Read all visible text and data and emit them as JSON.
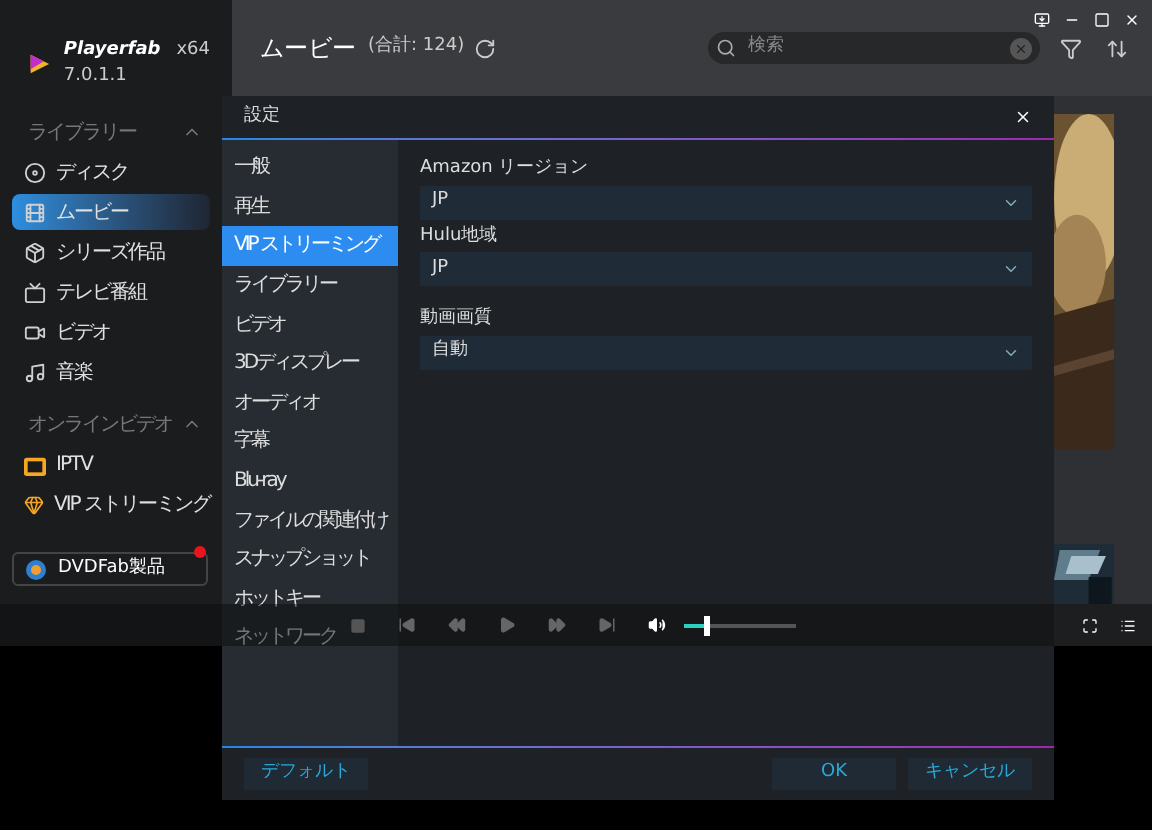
{
  "app": {
    "name": "Playerfab",
    "arch": "x64",
    "version": "7.0.1.1"
  },
  "sidebar": {
    "sections": [
      {
        "title": "ライブラリー",
        "expanded": true,
        "items": [
          {
            "label": "ディスク",
            "kind": "disc",
            "selected": false
          },
          {
            "label": "ムービー",
            "kind": "film",
            "selected": true
          },
          {
            "label": "シリーズ作品",
            "kind": "box",
            "selected": false
          },
          {
            "label": "テレビ番組",
            "kind": "tv",
            "selected": false
          },
          {
            "label": "ビデオ",
            "kind": "camera",
            "selected": false
          },
          {
            "label": "音楽",
            "kind": "music",
            "selected": false
          }
        ]
      },
      {
        "title": "オンラインビデオ",
        "expanded": true,
        "items": [
          {
            "label": "IPTV",
            "kind": "iptv",
            "selected": false
          },
          {
            "label": "VIP ストリーミング",
            "kind": "vip",
            "selected": false
          }
        ]
      }
    ],
    "product_button": {
      "label": "DVDFab製品",
      "notification": true
    }
  },
  "header": {
    "title": "ムービー",
    "count": "(合計: 124)",
    "search": {
      "placeholder": "検索"
    }
  },
  "settings": {
    "title": "設定",
    "nav": [
      {
        "label": "一般",
        "selected": false
      },
      {
        "label": "再生",
        "selected": false
      },
      {
        "label": "VIP ストリーミング",
        "selected": true
      },
      {
        "label": "ライブラリー",
        "selected": false
      },
      {
        "label": "ビデオ",
        "selected": false
      },
      {
        "label": "3Dディスプレー",
        "selected": false
      },
      {
        "label": "オーディオ",
        "selected": false
      },
      {
        "label": "字幕",
        "selected": false
      },
      {
        "label": "Blu-ray",
        "selected": false
      },
      {
        "label": "ファイルの関連付け",
        "selected": false
      },
      {
        "label": "スナップショット",
        "selected": false
      },
      {
        "label": "ホットキー",
        "selected": false
      },
      {
        "label": "ネットワーク",
        "selected": false
      }
    ],
    "groups": [
      [
        {
          "label": "Amazon リージョン",
          "value": "JP"
        },
        {
          "label": "Hulu地域",
          "value": "JP"
        }
      ],
      [
        {
          "label": "動画画質",
          "value": "自動"
        }
      ]
    ],
    "default_button": "デフォルト",
    "ok_button": "OK",
    "cancel_button": "キャンセル"
  },
  "player": {
    "volume": {
      "level": 0.2
    }
  }
}
